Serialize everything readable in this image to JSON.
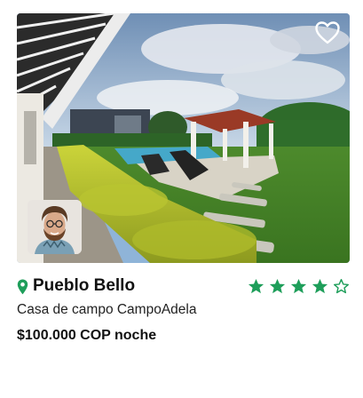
{
  "listing": {
    "location": "Pueblo Bello",
    "property_name": "Casa de campo CampoAdela",
    "price_label": "$100.000 COP noche",
    "rating_stars": 4,
    "rating_max": 5,
    "favorite_icon": "heart-outline-icon",
    "location_icon": "map-pin-icon",
    "photo_subject": "pool-garden-photo",
    "host_avatar": "host-avatar-photo"
  },
  "colors": {
    "accent_green": "#1e9e5a",
    "text_dark": "#111111",
    "star_empty_stroke": "#1e9e5a"
  }
}
